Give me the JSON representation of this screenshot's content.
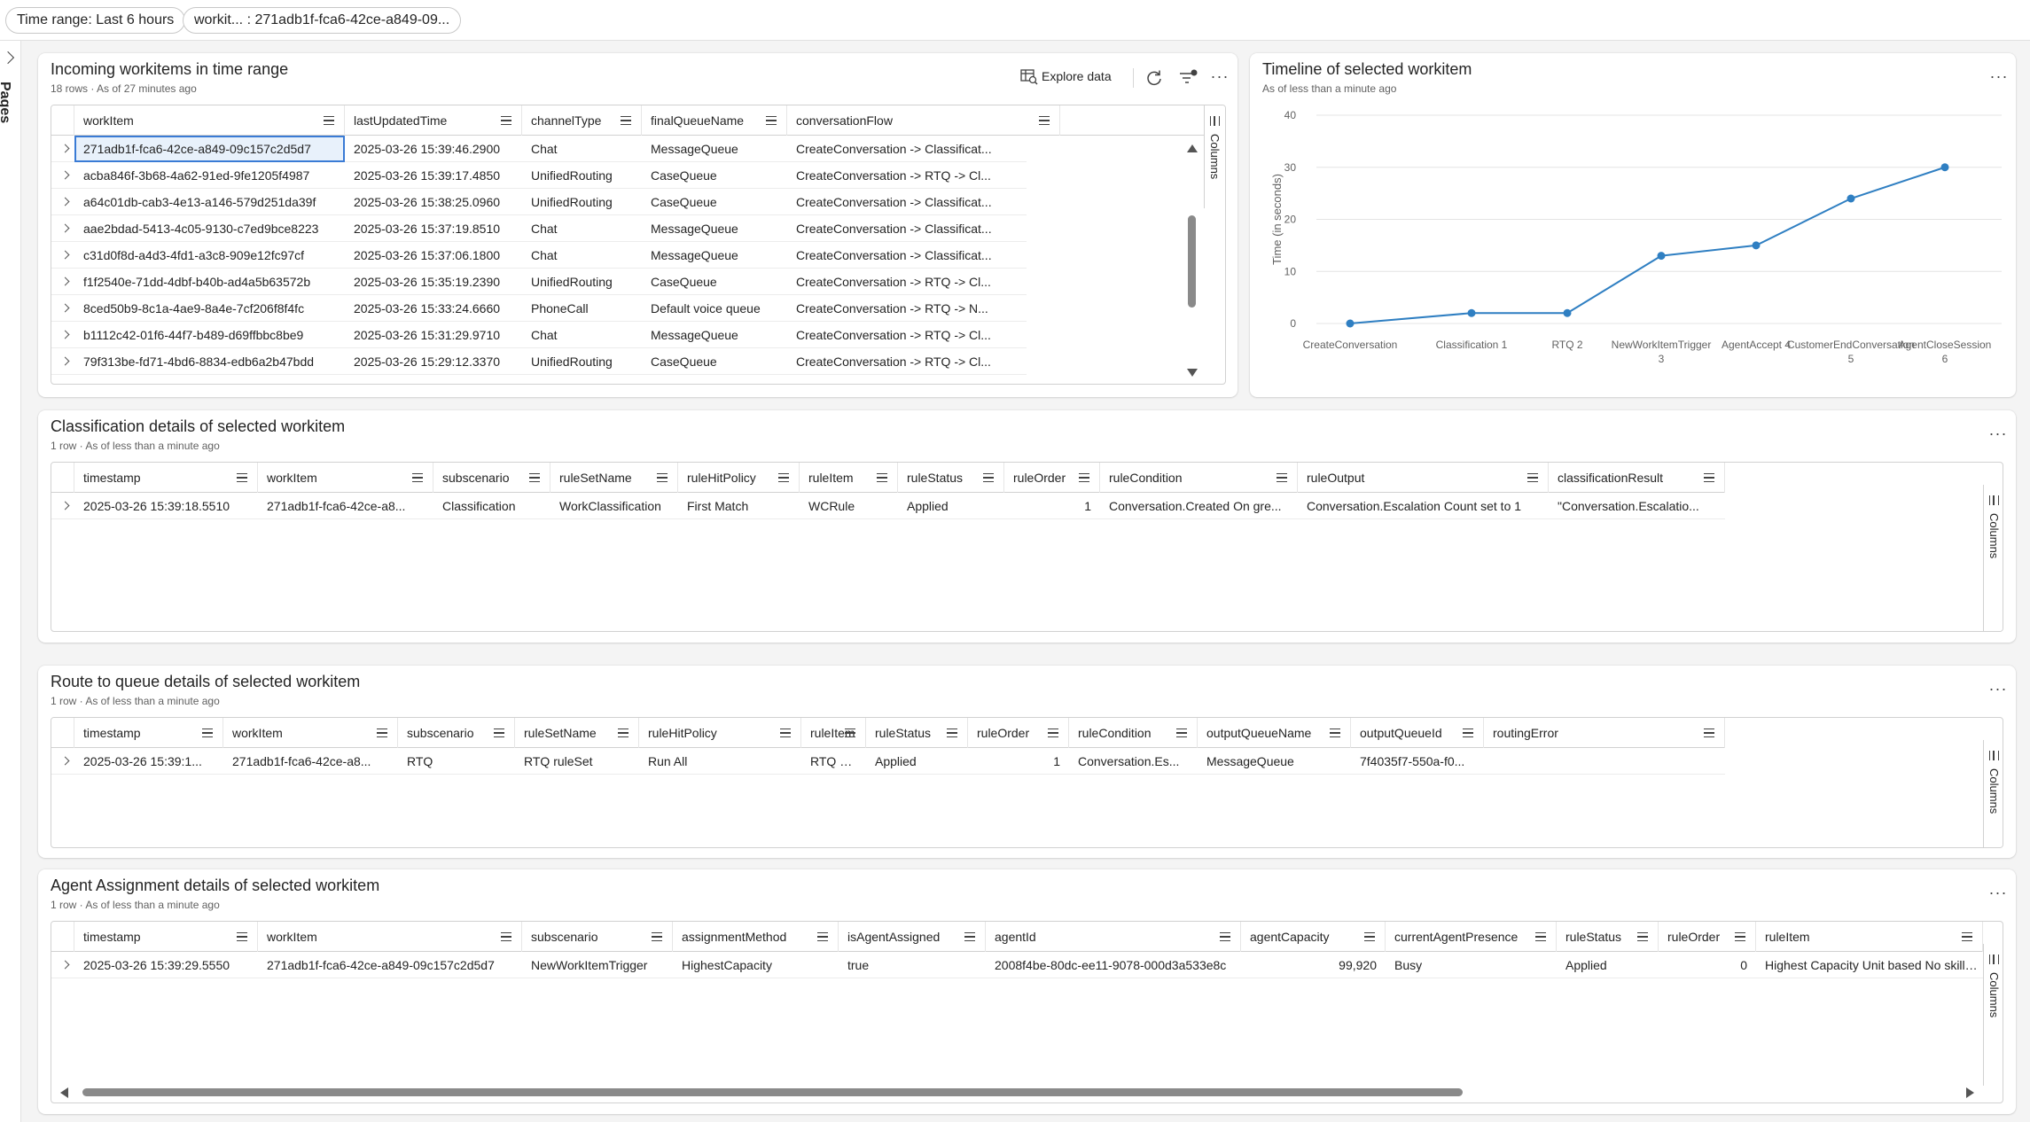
{
  "filters": {
    "time_range_key": "Time range:",
    "time_range_value": "Last 6 hours",
    "workitem_key": "workit... :",
    "workitem_value": "271adb1f-fca6-42ce-a849-09..."
  },
  "rail": {
    "label": "Pages"
  },
  "incoming": {
    "title": "Incoming workitems in time range",
    "subtitle": "18 rows · As of 27 minutes ago",
    "explore_label": "Explore data",
    "columns_label": "Columns",
    "headers": [
      "workItem",
      "lastUpdatedTime",
      "channelType",
      "finalQueueName",
      "conversationFlow"
    ],
    "rows": [
      [
        "271adb1f-fca6-42ce-a849-09c157c2d5d7",
        "2025-03-26 15:39:46.2900",
        "Chat",
        "MessageQueue",
        "CreateConversation -> Classificat..."
      ],
      [
        "acba846f-3b68-4a62-91ed-9fe1205f4987",
        "2025-03-26 15:39:17.4850",
        "UnifiedRouting",
        "CaseQueue",
        "CreateConversation -> RTQ -> Cl..."
      ],
      [
        "a64c01db-cab3-4e13-a146-579d251da39f",
        "2025-03-26 15:38:25.0960",
        "UnifiedRouting",
        "CaseQueue",
        "CreateConversation -> Classificat..."
      ],
      [
        "aae2bdad-5413-4c05-9130-c7ed9bce8223",
        "2025-03-26 15:37:19.8510",
        "Chat",
        "MessageQueue",
        "CreateConversation -> Classificat..."
      ],
      [
        "c31d0f8d-a4d3-4fd1-a3c8-909e12fc97cf",
        "2025-03-26 15:37:06.1800",
        "Chat",
        "MessageQueue",
        "CreateConversation -> Classificat..."
      ],
      [
        "f1f2540e-71dd-4dbf-b40b-ad4a5b63572b",
        "2025-03-26 15:35:19.2390",
        "UnifiedRouting",
        "CaseQueue",
        "CreateConversation -> RTQ -> Cl..."
      ],
      [
        "8ced50b9-8c1a-4ae9-8a4e-7cf206f8f4fc",
        "2025-03-26 15:33:24.6660",
        "PhoneCall",
        "Default voice queue",
        "CreateConversation -> RTQ -> N..."
      ],
      [
        "b1112c42-01f6-44f7-b489-d69ffbbc8be9",
        "2025-03-26 15:31:29.9710",
        "Chat",
        "MessageQueue",
        "CreateConversation -> RTQ -> Cl..."
      ],
      [
        "79f313be-fd71-4bd6-8834-edb6a2b47bdd",
        "2025-03-26 15:29:12.3370",
        "UnifiedRouting",
        "CaseQueue",
        "CreateConversation -> RTQ -> Cl..."
      ]
    ]
  },
  "timeline": {
    "title": "Timeline of selected workitem",
    "subtitle": "As of less than a minute ago"
  },
  "chart_data": {
    "type": "line",
    "ylabel": "Time (in seconds)",
    "xlabel": "",
    "ylim": [
      0,
      40
    ],
    "yticks": [
      0,
      10,
      20,
      30,
      40
    ],
    "categories": [
      "CreateConversation",
      "Classification 1",
      "RTQ 2",
      "NewWorkItemTrigger 3",
      "AgentAccept 4",
      "CustomerEndConversation 5",
      "AgentCloseSession 6"
    ],
    "tick_labels": [
      [
        "CreateConversation"
      ],
      [
        "Classification 1"
      ],
      [
        "RTQ 2"
      ],
      [
        "NewWorkItemTrigger",
        "3"
      ],
      [
        "AgentAccept 4"
      ],
      [
        "CustomerEndConversation",
        "5"
      ],
      [
        "AgentCloseSession",
        "6"
      ]
    ],
    "values": [
      0,
      2,
      2,
      13,
      15,
      24,
      30
    ],
    "grid": true,
    "color": "#2f7fc2"
  },
  "classification": {
    "title": "Classification details of selected workitem",
    "subtitle": "1 row · As of less than a minute ago",
    "columns_label": "Columns",
    "headers": [
      "timestamp",
      "workItem",
      "subscenario",
      "ruleSetName",
      "ruleHitPolicy",
      "ruleItem",
      "ruleStatus",
      "ruleOrder",
      "ruleCondition",
      "ruleOutput",
      "classificationResult"
    ],
    "rows": [
      [
        "2025-03-26 15:39:18.5510",
        "271adb1f-fca6-42ce-a8...",
        "Classification",
        "WorkClassification",
        "First Match",
        "WCRule",
        "Applied",
        "1",
        "Conversation.Created On gre...",
        "Conversation.Escalation Count set to 1",
        "\"Conversation.Escalatio..."
      ]
    ]
  },
  "rtq": {
    "title": "Route to queue details of selected workitem",
    "subtitle": "1 row · As of less than a minute ago",
    "columns_label": "Columns",
    "headers": [
      "timestamp",
      "workItem",
      "subscenario",
      "ruleSetName",
      "ruleHitPolicy",
      "ruleItem",
      "ruleStatus",
      "ruleOrder",
      "ruleCondition",
      "outputQueueName",
      "outputQueueId",
      "routingError"
    ],
    "rows": [
      [
        "2025-03-26 15:39:1...",
        "271adb1f-fca6-42ce-a8...",
        "RTQ",
        "RTQ ruleSet",
        "Run All",
        "RTQ Rule",
        "Applied",
        "1",
        "Conversation.Es...",
        "MessageQueue",
        "7f4035f7-550a-f0...",
        ""
      ]
    ]
  },
  "agent": {
    "title": "Agent Assignment details of selected workitem",
    "subtitle": "1 row · As of less than a minute ago",
    "columns_label": "Columns",
    "headers": [
      "timestamp",
      "workItem",
      "subscenario",
      "assignmentMethod",
      "isAgentAssigned",
      "agentId",
      "agentCapacity",
      "currentAgentPresence",
      "ruleStatus",
      "ruleOrder",
      "ruleItem"
    ],
    "rows": [
      [
        "2025-03-26 15:39:29.5550",
        "271adb1f-fca6-42ce-a849-09c157c2d5d7",
        "NewWorkItemTrigger",
        "HighestCapacity",
        "true",
        "2008f4be-80dc-ee11-9078-000d3a533e8c",
        "99,920",
        "Busy",
        "Applied",
        "0",
        "Highest Capacity Unit based No skill m..."
      ]
    ]
  }
}
